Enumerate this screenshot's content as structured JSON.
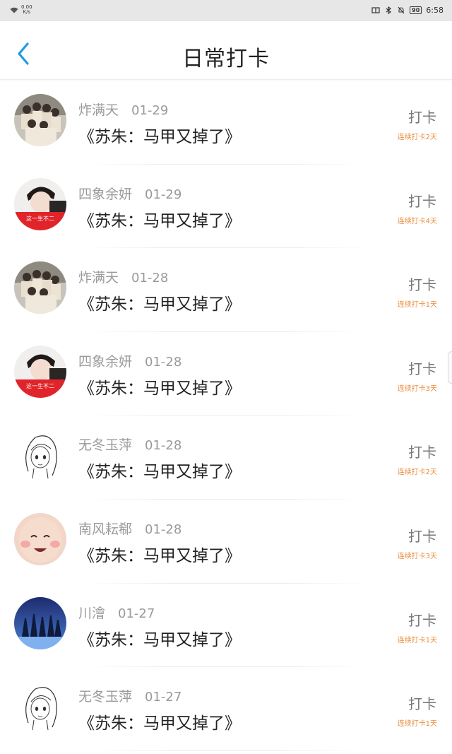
{
  "status_bar": {
    "net_speed": "0.00\nK/s",
    "battery": "90",
    "time": "6:58",
    "icons": [
      "wifi-icon",
      "sim-icon",
      "bluetooth-icon",
      "mute-icon",
      "battery-icon"
    ]
  },
  "header": {
    "back_icon": "chevron-left-icon",
    "title": "日常打卡",
    "accent_color": "#1e9be6"
  },
  "checkins": [
    {
      "user": "炸满天",
      "date": "01-29",
      "book": "《苏朱：马甲又掉了》",
      "action": "打卡",
      "streak": "连续打卡2天",
      "avatar": "group-photo"
    },
    {
      "user": "四象余妍",
      "date": "01-29",
      "book": "《苏朱：马甲又掉了》",
      "action": "打卡",
      "streak": "连续打卡4天",
      "avatar": "boy-red"
    },
    {
      "user": "炸满天",
      "date": "01-28",
      "book": "《苏朱：马甲又掉了》",
      "action": "打卡",
      "streak": "连续打卡1天",
      "avatar": "group-photo"
    },
    {
      "user": "四象余妍",
      "date": "01-28",
      "book": "《苏朱：马甲又掉了》",
      "action": "打卡",
      "streak": "连续打卡3天",
      "avatar": "boy-red"
    },
    {
      "user": "无冬玉萍",
      "date": "01-28",
      "book": "《苏朱：马甲又掉了》",
      "action": "打卡",
      "streak": "连续打卡2天",
      "avatar": "sketch-girl"
    },
    {
      "user": "南风耘郗",
      "date": "01-28",
      "book": "《苏朱：马甲又掉了》",
      "action": "打卡",
      "streak": "连续打卡3天",
      "avatar": "baby-face"
    },
    {
      "user": "川澮",
      "date": "01-27",
      "book": "《苏朱：马甲又掉了》",
      "action": "打卡",
      "streak": "连续打卡1天",
      "avatar": "night-trees"
    },
    {
      "user": "无冬玉萍",
      "date": "01-27",
      "book": "《苏朱：马甲又掉了》",
      "action": "打卡",
      "streak": "连续打卡1天",
      "avatar": "sketch-girl"
    }
  ],
  "colors": {
    "streak": "#e98b3a",
    "name": "#9a9a9a",
    "book": "#222222"
  }
}
